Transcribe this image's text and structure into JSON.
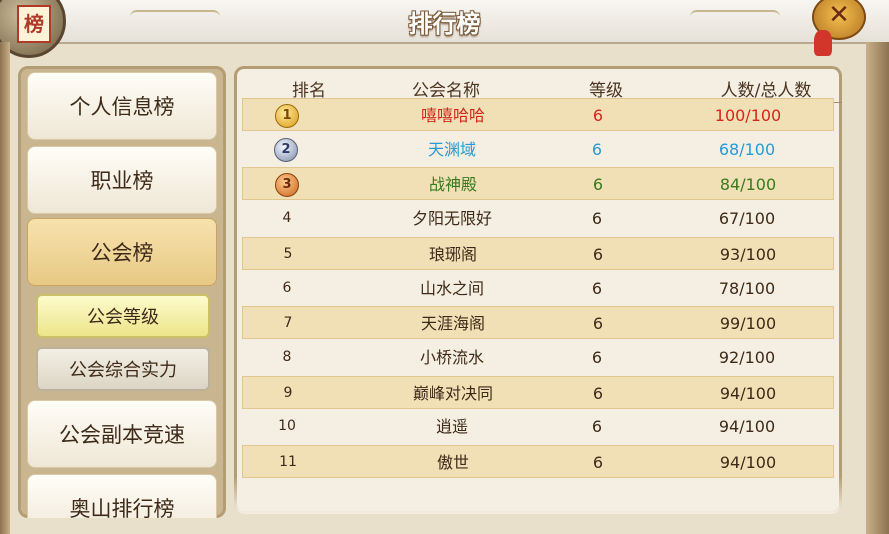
{
  "window": {
    "title": "排行榜",
    "logo_text": "榜",
    "close_label": "✕"
  },
  "sidebar": {
    "items": [
      {
        "label": "个人信息榜"
      },
      {
        "label": "职业榜"
      },
      {
        "label": "公会榜"
      },
      {
        "label": "公会副本竞速"
      },
      {
        "label": "奥山排行榜"
      }
    ],
    "subitems": [
      {
        "label": "公会等级"
      },
      {
        "label": "公会综合实力"
      }
    ]
  },
  "table": {
    "headers": {
      "rank": "排名",
      "name": "公会名称",
      "level": "等级",
      "members": "人数/总人数"
    },
    "rows": [
      {
        "rank": "1",
        "name": "嘻嘻哈哈",
        "level": "6",
        "members": "100/100"
      },
      {
        "rank": "2",
        "name": "天渊域",
        "level": "6",
        "members": "68/100"
      },
      {
        "rank": "3",
        "name": "战神殿",
        "level": "6",
        "members": "84/100"
      },
      {
        "rank": "4",
        "name": "夕阳无限好",
        "level": "6",
        "members": "67/100"
      },
      {
        "rank": "5",
        "name": "琅琊阁",
        "level": "6",
        "members": "93/100"
      },
      {
        "rank": "6",
        "name": "山水之间",
        "level": "6",
        "members": "78/100"
      },
      {
        "rank": "7",
        "name": "天涯海阁",
        "level": "6",
        "members": "99/100"
      },
      {
        "rank": "8",
        "name": "小桥流水",
        "level": "6",
        "members": "92/100"
      },
      {
        "rank": "9",
        "name": "巅峰对决同",
        "level": "6",
        "members": "94/100"
      },
      {
        "rank": "10",
        "name": "逍遥",
        "level": "6",
        "members": "94/100"
      },
      {
        "rank": "11",
        "name": "傲世",
        "level": "6",
        "members": "94/100"
      }
    ]
  },
  "colors": {
    "rank1": "#d4261c",
    "rank2": "#2a9ad6",
    "rank3": "#3a7a1e",
    "normal": "#3e2a18"
  }
}
